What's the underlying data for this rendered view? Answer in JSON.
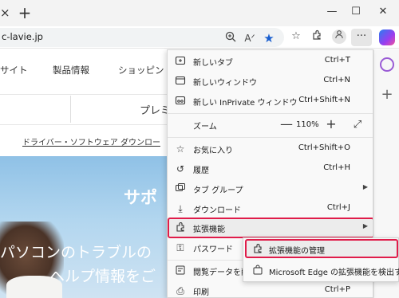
{
  "browser": {
    "tab_close_glyph": "×",
    "new_tab_glyph": "+",
    "window_controls": {
      "minimize": "—",
      "maximize": "☐",
      "close": "✕"
    },
    "url": "c-lavie.jp",
    "more_glyph": "···"
  },
  "site": {
    "nav": [
      "サイト",
      "製品情報",
      "ショッピン"
    ],
    "premium_text": "プレミ",
    "download_link": "ドライバー・ソフトウェア ダウンロー",
    "hero_title": "サポ",
    "hero_line1": "パソコンのトラブルの",
    "hero_line2": "ヘルプ情報をご"
  },
  "menu": {
    "items": [
      {
        "label": "新しいタブ",
        "shortcut": "Ctrl+T",
        "icon": "new-tab-icon"
      },
      {
        "label": "新しいウィンドウ",
        "shortcut": "Ctrl+N",
        "icon": "new-window-icon"
      },
      {
        "label": "新しい InPrivate ウィンドウ",
        "shortcut": "Ctrl+Shift+N",
        "icon": "inprivate-icon"
      },
      {
        "label": "お気に入り",
        "shortcut": "Ctrl+Shift+O",
        "icon": "favorites-icon"
      },
      {
        "label": "履歴",
        "shortcut": "Ctrl+H",
        "icon": "history-icon"
      },
      {
        "label": "タブ グループ",
        "shortcut": "",
        "icon": "tab-groups-icon"
      },
      {
        "label": "ダウンロード",
        "shortcut": "Ctrl+J",
        "icon": "download-icon"
      },
      {
        "label": "拡張機能",
        "shortcut": "",
        "icon": "extensions-icon"
      },
      {
        "label": "パスワード",
        "shortcut": "",
        "icon": "password-icon"
      },
      {
        "label": "閲覧データを削除",
        "shortcut": "",
        "icon": "clear-data-icon"
      },
      {
        "label": "印刷",
        "shortcut": "Ctrl+P",
        "icon": "print-icon"
      }
    ],
    "zoom": {
      "label": "ズーム",
      "minus": "—",
      "value": "110%",
      "plus": "+"
    }
  },
  "submenu": {
    "manage_extensions": "拡張機能の管理",
    "edge_extensions": "Microsoft Edge の拡張機能を検出する"
  },
  "colors": {
    "highlight": "#e01c4a",
    "favorite_star": "#1a5fcf"
  }
}
